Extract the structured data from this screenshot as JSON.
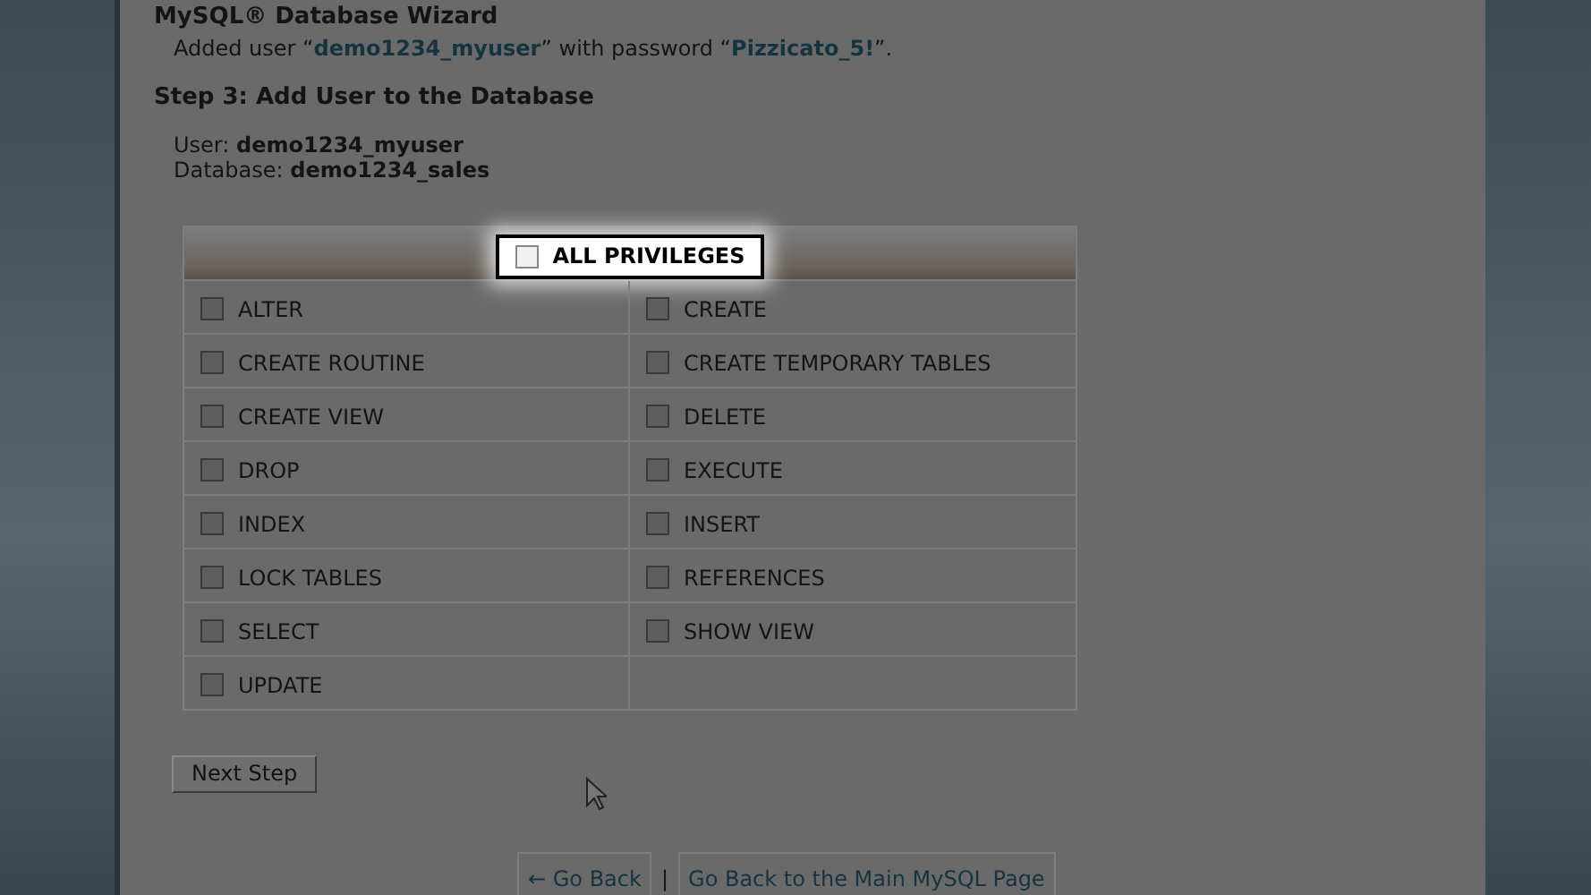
{
  "page_title": "MySQL® Database Wizard",
  "message": {
    "prefix": "Added user “",
    "user": "demo1234_myuser",
    "middle": "” with password “",
    "password": "Pizzicato_5!",
    "suffix": "”."
  },
  "step_heading": "Step 3: Add User to the Database",
  "user_label": "User:",
  "user_value": "demo1234_myuser",
  "database_label": "Database:",
  "database_value": "demo1234_sales",
  "all_privileges": {
    "label": "ALL PRIVILEGES",
    "checked": false
  },
  "privileges": [
    {
      "label": "ALTER",
      "checked": false
    },
    {
      "label": "CREATE",
      "checked": false
    },
    {
      "label": "CREATE ROUTINE",
      "checked": false
    },
    {
      "label": "CREATE TEMPORARY TABLES",
      "checked": false
    },
    {
      "label": "CREATE VIEW",
      "checked": false
    },
    {
      "label": "DELETE",
      "checked": false
    },
    {
      "label": "DROP",
      "checked": false
    },
    {
      "label": "EXECUTE",
      "checked": false
    },
    {
      "label": "INDEX",
      "checked": false
    },
    {
      "label": "INSERT",
      "checked": false
    },
    {
      "label": "LOCK TABLES",
      "checked": false
    },
    {
      "label": "REFERENCES",
      "checked": false
    },
    {
      "label": "SELECT",
      "checked": false
    },
    {
      "label": "SHOW VIEW",
      "checked": false
    },
    {
      "label": "UPDATE",
      "checked": false
    }
  ],
  "next_button": "Next Step",
  "footer_links": [
    {
      "label": "← Go Back"
    },
    {
      "label": "Go Back to the Main MySQL Page"
    }
  ],
  "footer_separator": "|"
}
